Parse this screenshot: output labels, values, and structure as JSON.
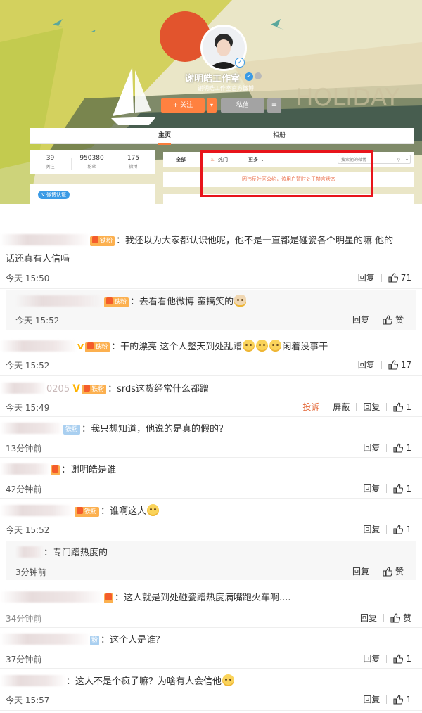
{
  "profile": {
    "name": "谢明皓工作室",
    "intro": "谢明皓工作室官方微博",
    "banner_text": "HOLIDAY",
    "follow_label": "+ 关注",
    "message_label": "私信",
    "tabs": [
      "主页",
      "相册"
    ],
    "stats": [
      {
        "value": "39",
        "label": "关注"
      },
      {
        "value": "950380",
        "label": "粉丝"
      },
      {
        "value": "175",
        "label": "微博"
      }
    ],
    "verified_tag": "V 微博认证",
    "feed_tabs": [
      "全部",
      "热门",
      "更多"
    ],
    "search_placeholder": "搜索他的微博",
    "notice": "因违反社区公约，该用户暂时处于禁言状态",
    "colors": {
      "accent": "#ff8140",
      "highlight_box": "#e8141b",
      "notice_text": "#eb7350"
    }
  },
  "comments": {
    "reply_label": "回复",
    "report_label": "投诉",
    "block_label": "屏蔽",
    "like_empty_label": "赞",
    "fan_badge_label": "铁粉",
    "items": [
      {
        "text": "：我还以为大家都认识他呢，他不是一直都是碰瓷各个明星的嘛 他的",
        "text2": "话还真有人信吗",
        "time": "今天 15:50",
        "likes": "71"
      },
      {
        "text": "：去看看他微博 蛮搞笑的",
        "time": "今天 15:52",
        "likes": "赞"
      },
      {
        "text": "：干的漂亮 这个人整天到处乱蹭",
        "text_tail": "闲着没事干",
        "time": "今天 15:52",
        "likes": "17"
      },
      {
        "user_fragment": "0205",
        "text": "：srds这货经常什么都蹭",
        "time": "今天 15:49",
        "likes": "1"
      },
      {
        "text": "：我只想知道，他说的是真的假的？",
        "time": "13分钟前",
        "likes": "1"
      },
      {
        "text": "：谢明皓是谁",
        "time": "42分钟前",
        "likes": "1"
      },
      {
        "text": "：谁啊这人",
        "time": "今天 15:52",
        "likes": "1"
      },
      {
        "text": "：专门蹭热度的",
        "time": "3分钟前",
        "likes": "赞"
      },
      {
        "text": "：这人就是到处碰瓷蹭热度满嘴跑火车啊....",
        "time": "34分钟前",
        "likes": "赞"
      },
      {
        "text": "：这个人是谁？",
        "time": "37分钟前",
        "likes": "1"
      },
      {
        "text": "：这人不是个疯子嘛？为啥有人会信他",
        "time": "今天 15:57",
        "likes": "1"
      }
    ]
  }
}
